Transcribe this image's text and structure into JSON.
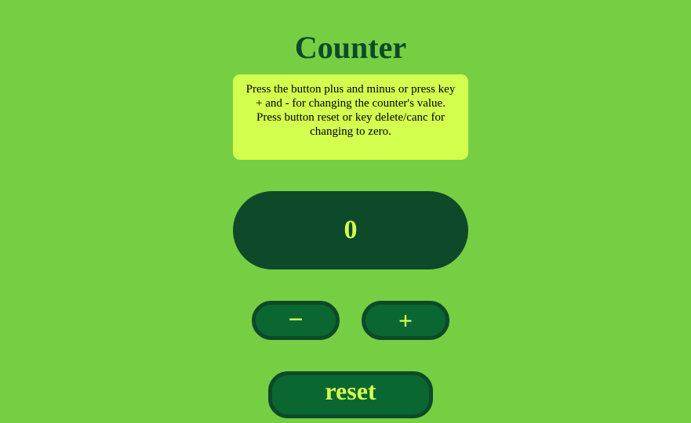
{
  "page": {
    "title": "Counter"
  },
  "instructions": {
    "line1": "Press the button plus and minus or press key + and - for changing the counter's value.",
    "line2": "Press button reset or key delete/canc for changing to zero."
  },
  "counter": {
    "value": "0"
  },
  "buttons": {
    "minus_label": "−",
    "plus_label": "+",
    "reset_label": "reset"
  },
  "colors": {
    "background": "#76cf42",
    "dark_green": "#0c4a2a",
    "button_green": "#0b6732",
    "accent_yellow": "#d3ff4e"
  }
}
